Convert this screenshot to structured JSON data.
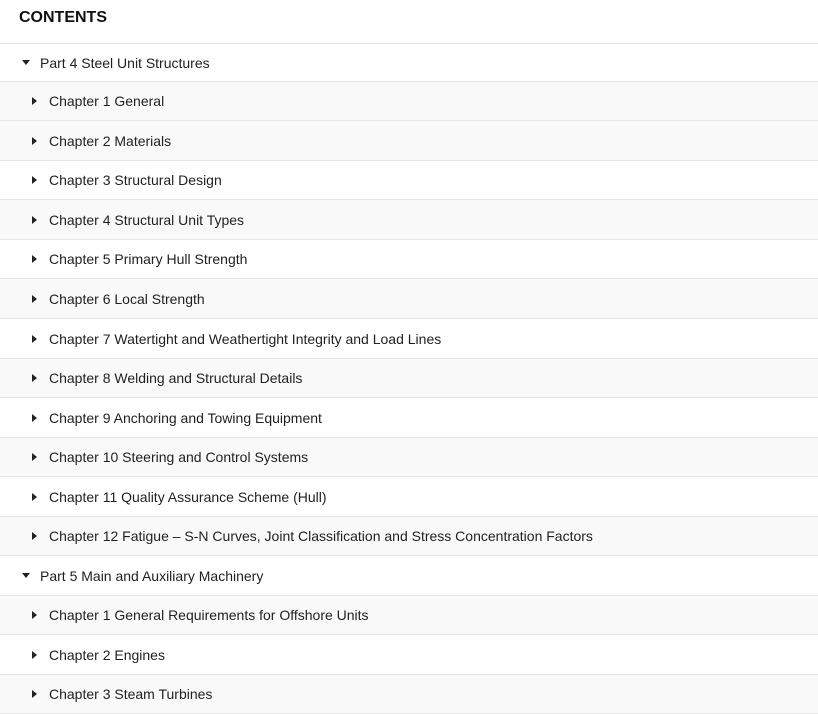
{
  "contents": {
    "title": "CONTENTS",
    "parts": [
      {
        "label": "Part 4 Steel Unit Structures",
        "icon": "caret-down-icon",
        "chapters": [
          "Chapter 1 General",
          "Chapter 2 Materials",
          "Chapter 3 Structural Design",
          "Chapter 4 Structural Unit Types",
          "Chapter 5 Primary Hull Strength",
          "Chapter 6 Local Strength",
          "Chapter 7 Watertight and Weathertight Integrity and Load Lines",
          "Chapter 8 Welding and Structural Details",
          "Chapter 9 Anchoring and Towing Equipment",
          "Chapter 10 Steering and Control Systems",
          "Chapter 11 Quality Assurance Scheme (Hull)",
          "Chapter 12 Fatigue – S-N Curves, Joint Classification and Stress Concentration Factors"
        ]
      },
      {
        "label": "Part 5 Main and Auxiliary Machinery",
        "icon": "caret-down-icon",
        "chapters": [
          "Chapter 1 General Requirements for Offshore Units",
          "Chapter 2 Engines",
          "Chapter 3 Steam Turbines"
        ]
      }
    ]
  },
  "colors": {
    "row_alt": "#f9f9f9",
    "divider": "#e6e6e6",
    "text": "#1f1f1f"
  }
}
